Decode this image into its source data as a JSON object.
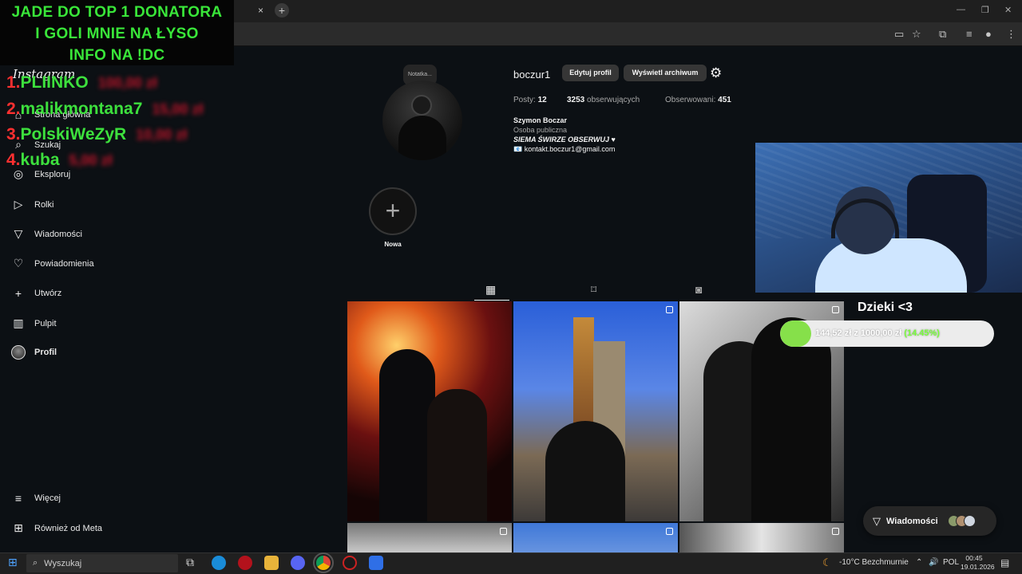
{
  "browser": {
    "tab_close": "×",
    "new_tab": "+",
    "window_controls": [
      "—",
      "❐",
      "✕"
    ]
  },
  "overlay": {
    "title_lines": [
      "JADE DO TOP 1 DONATORA",
      "I GOLI MNIE NA ŁYSO",
      "INFO NA !DC"
    ],
    "ranking": [
      {
        "num": "1.",
        "name": "PLIINKO",
        "amount": "100,00 zł"
      },
      {
        "num": "2.",
        "name": "malikmontana7",
        "amount": "15,00 zł"
      },
      {
        "num": "3.",
        "name": "PolskiWeZyR",
        "amount": "10,00 zł"
      },
      {
        "num": "4.",
        "name": "kuba",
        "amount": "5,00 zł"
      }
    ]
  },
  "sidebar": {
    "logo": "Instagram",
    "items": [
      {
        "label": "Strona główna",
        "icon": "home-icon",
        "glyph": "⌂"
      },
      {
        "label": "Szukaj",
        "icon": "search-icon",
        "glyph": "⌕"
      },
      {
        "label": "Eksploruj",
        "icon": "compass-icon",
        "glyph": "◎"
      },
      {
        "label": "Rolki",
        "icon": "reels-icon",
        "glyph": "▷"
      },
      {
        "label": "Wiadomości",
        "icon": "messages-icon",
        "glyph": "▽"
      },
      {
        "label": "Powiadomienia",
        "icon": "heart-icon",
        "glyph": "♡"
      },
      {
        "label": "Utwórz",
        "icon": "plus-icon",
        "glyph": "+"
      },
      {
        "label": "Pulpit",
        "icon": "dashboard-icon",
        "glyph": "▥"
      },
      {
        "label": "Profil",
        "icon": "avatar",
        "glyph": ""
      }
    ],
    "more": {
      "label": "Więcej",
      "glyph": "≡"
    },
    "meta": {
      "label": "Również od Meta",
      "glyph": "⊞"
    }
  },
  "profile": {
    "note": "Notatka...",
    "username": "boczur1",
    "edit_button": "Edytuj profil",
    "archive_button": "Wyświetl archiwum",
    "stats": {
      "posts_label": "Posty:",
      "posts": "12",
      "followers": "3253",
      "followers_label": "obserwujących",
      "following_label": "Obserwowani:",
      "following": "451"
    },
    "bio": {
      "name": "Szymon Boczar",
      "category": "Osoba publiczna",
      "line": "SIEMA ŚWIRZE OBSERWUJ ♥",
      "email": "📧 kontakt.boczur1@gmail.com"
    },
    "highlight_new": "Nowa",
    "tabs": [
      "grid-icon",
      "bookmark-icon",
      "tagged-icon"
    ]
  },
  "goal": {
    "title": "Dzieki <3",
    "text": "144,52 zł z 1000,00 zł",
    "percent_label": "(14.45%)",
    "fraction": 0.1445
  },
  "messages": {
    "label": "Wiadomości"
  },
  "taskbar": {
    "search_placeholder": "Wyszukaj",
    "weather": "-10°C  Bezchmurnie",
    "lang": "POL",
    "time": "00:45",
    "date": "19.01.2026"
  },
  "colors": {
    "ig_bg": "#0c1014",
    "overlay_green": "#39e639",
    "overlay_red": "#ff3030",
    "goal_green": "#86e04a"
  }
}
